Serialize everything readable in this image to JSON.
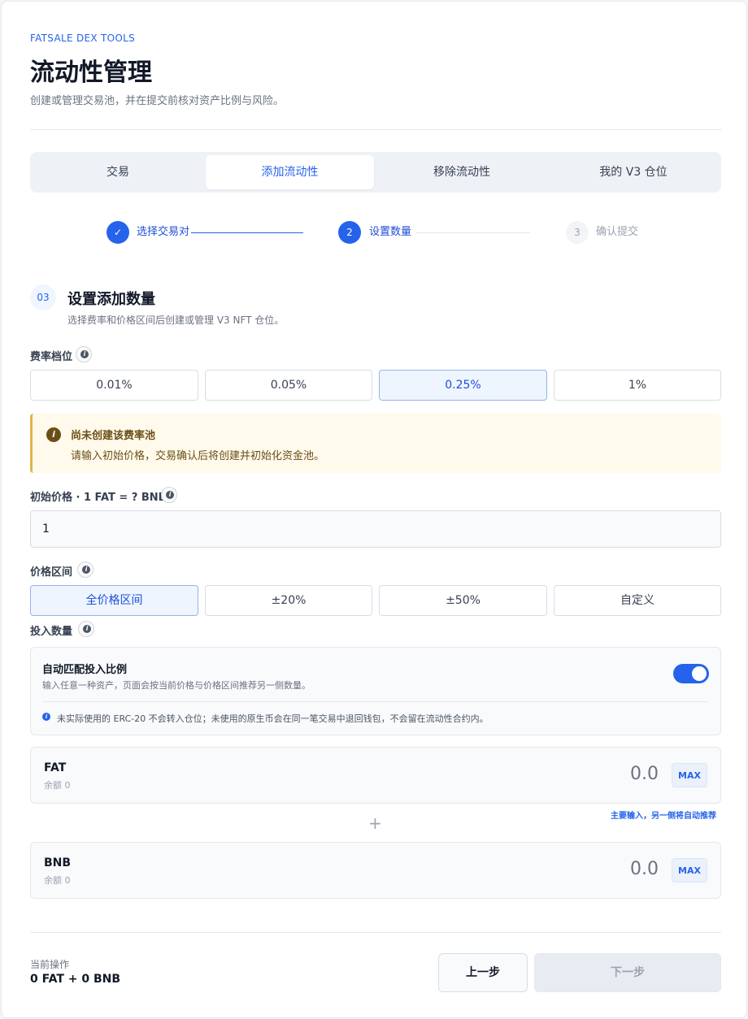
{
  "header": {
    "brand": "FATSALE DEX TOOLS",
    "title": "流动性管理",
    "subtitle": "创建或管理交易池，并在提交前核对资产比例与风险。"
  },
  "tabs": [
    {
      "label": "交易"
    },
    {
      "label": "添加流动性",
      "active": true
    },
    {
      "label": "移除流动性"
    },
    {
      "label": "我的 V3 仓位"
    }
  ],
  "steps": [
    {
      "index": "✓",
      "label": "选择交易对",
      "status": "done"
    },
    {
      "index": "2",
      "label": "设置数量",
      "status": "current"
    },
    {
      "index": "3",
      "label": "确认提交",
      "status": "pending"
    }
  ],
  "section": {
    "number": "03",
    "title": "设置添加数量",
    "desc": "选择费率和价格区间后创建或管理 V3 NFT 仓位。"
  },
  "fee": {
    "label": "费率档位",
    "options": [
      "0.01%",
      "0.05%",
      "0.25%",
      "1%"
    ],
    "selected": "0.25%"
  },
  "notice": {
    "title": "尚未创建该费率池",
    "desc": "请输入初始价格，交易确认后将创建并初始化资金池。"
  },
  "initial_price": {
    "label": "初始价格 · 1 FAT = ? BNB",
    "value": "1"
  },
  "range": {
    "label": "价格区间",
    "options": [
      "全价格区间",
      "±20%",
      "±50%",
      "自定义"
    ],
    "selected": "全价格区间"
  },
  "amount": {
    "label": "投入数量",
    "auto_title": "自动匹配投入比例",
    "auto_desc": "输入任意一种资产，页面会按当前价格与价格区间推荐另一侧数量。",
    "auto_enabled": true,
    "note": "未实际使用的 ERC-20 不会转入仓位；未使用的原生币会在同一笔交易中退回钱包，不会留在流动性合约内。",
    "tokens": [
      {
        "symbol": "FAT",
        "balance": "余额 0",
        "value": "0.0",
        "max": "MAX"
      },
      {
        "symbol": "BNB",
        "balance": "余额 0",
        "value": "0.0",
        "max": "MAX"
      }
    ],
    "hint": "主要输入，另一侧将自动推荐",
    "plus": "+"
  },
  "footer": {
    "current_label": "当前操作",
    "current_value": "0 FAT + 0 BNB",
    "prev": "上一步",
    "next": "下一步"
  },
  "colors": {
    "accent": "#2563eb",
    "notice_bg": "#fffaeb",
    "notice_text": "#6b4e16"
  }
}
